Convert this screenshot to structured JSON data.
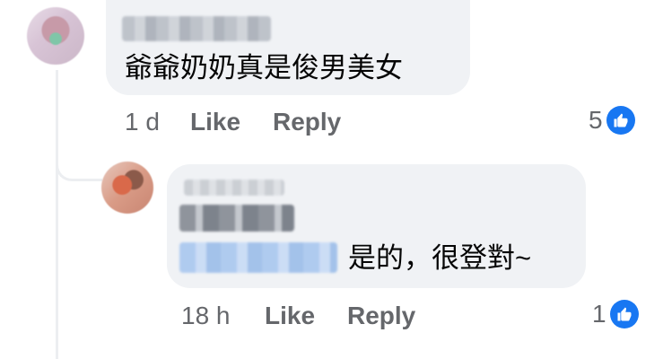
{
  "comments": [
    {
      "text": "爺爺奶奶真是俊男美女",
      "time": "1 d",
      "like_label": "Like",
      "reply_label": "Reply",
      "reaction_count": "5"
    },
    {
      "text": "是的，很登對~",
      "time": "18 h",
      "like_label": "Like",
      "reply_label": "Reply",
      "reaction_count": "1"
    }
  ],
  "colors": {
    "bubble": "#f0f2f5",
    "meta_text": "#65676b",
    "like_blue": "#1877f2",
    "thread_line": "#eceef1"
  },
  "icons": {
    "reaction": "thumbs-up-icon"
  }
}
